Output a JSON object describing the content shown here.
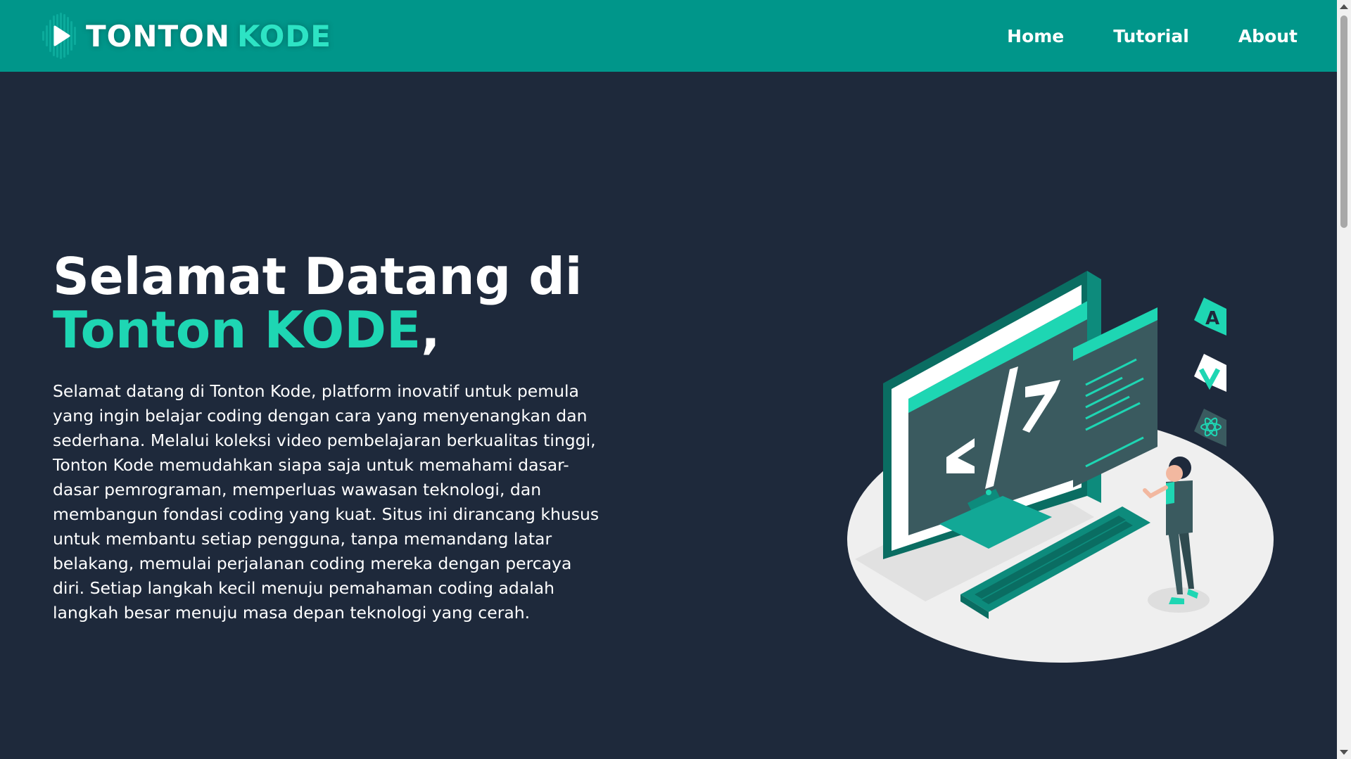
{
  "brand": {
    "name_part1": "TONTON",
    "name_part2": "KODE"
  },
  "nav": {
    "home": "Home",
    "tutorial": "Tutorial",
    "about": "About"
  },
  "hero": {
    "title_line1": "Selamat Datang di",
    "title_accent": "Tonton KODE",
    "title_comma": ",",
    "description": "Selamat datang di Tonton Kode, platform inovatif untuk pemula yang ingin belajar coding dengan cara yang menyenangkan dan sederhana. Melalui koleksi video pembelajaran berkualitas tinggi, Tonton Kode memudahkan siapa saja untuk memahami dasar-dasar pemrograman, memperluas wawasan teknologi, dan membangun fondasi coding yang kuat. Situs ini dirancang khusus untuk membantu setiap pengguna, tanpa memandang latar belakang, memulai perjalanan coding mereka dengan percaya diri. Setiap langkah kecil menuju pemahaman coding adalah langkah besar menuju masa depan teknologi yang cerah."
  },
  "colors": {
    "navbar": "#00968a",
    "background": "#1e293b",
    "accent": "#1ed6b3",
    "logo_accent": "#2de3c4"
  },
  "icons": {
    "logo": "play-icon",
    "framework_icons": [
      "angular-icon",
      "vue-icon",
      "react-icon"
    ],
    "illustration": "developer-illustration"
  }
}
